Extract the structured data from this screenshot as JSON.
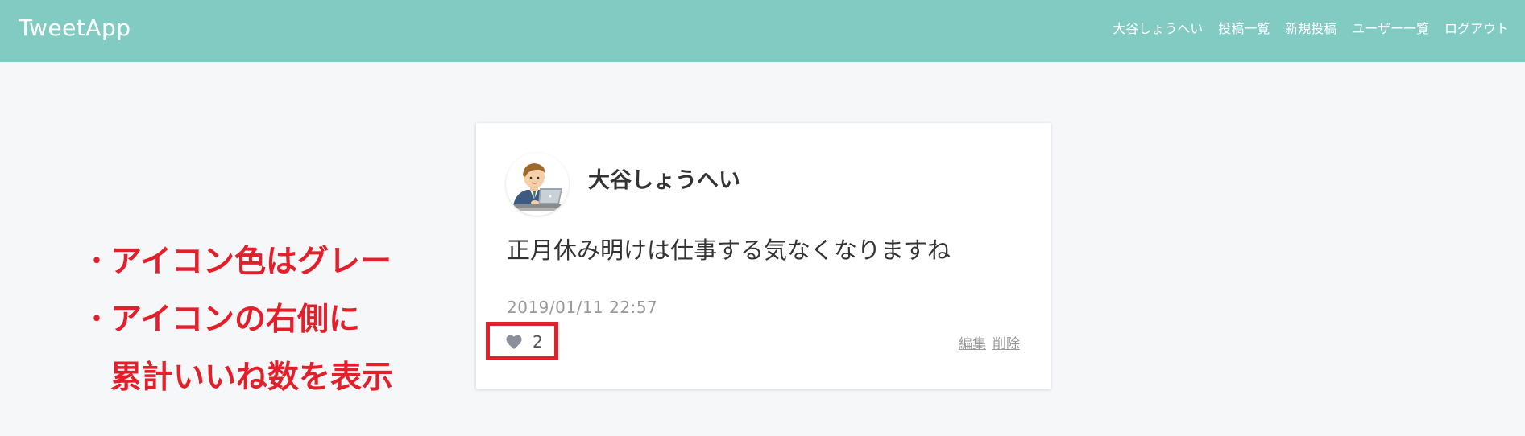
{
  "header": {
    "logo": "TweetApp",
    "nav": [
      {
        "label": "大谷しょうへい"
      },
      {
        "label": "投稿一覧"
      },
      {
        "label": "新規投稿"
      },
      {
        "label": "ユーザー一覧"
      },
      {
        "label": "ログアウト"
      }
    ],
    "background_color": "#82cbc3"
  },
  "annotation": {
    "bullet": "・",
    "line1": "アイコン色はグレー",
    "line2": "アイコンの右側に",
    "line3": "累計いいね数を表示",
    "color": "#e2202b"
  },
  "post": {
    "user_name": "大谷しょうへい",
    "avatar_icon": "businessman-laptop-avatar",
    "content": "正月休み明けは仕事する気なくなりますね",
    "date": "2019/01/11 22:57",
    "like_icon": "heart-icon",
    "like_icon_color": "#8a8f99",
    "like_count": "2",
    "edit_label": "編集",
    "delete_label": "削除",
    "highlight_color": "#e2202b"
  }
}
